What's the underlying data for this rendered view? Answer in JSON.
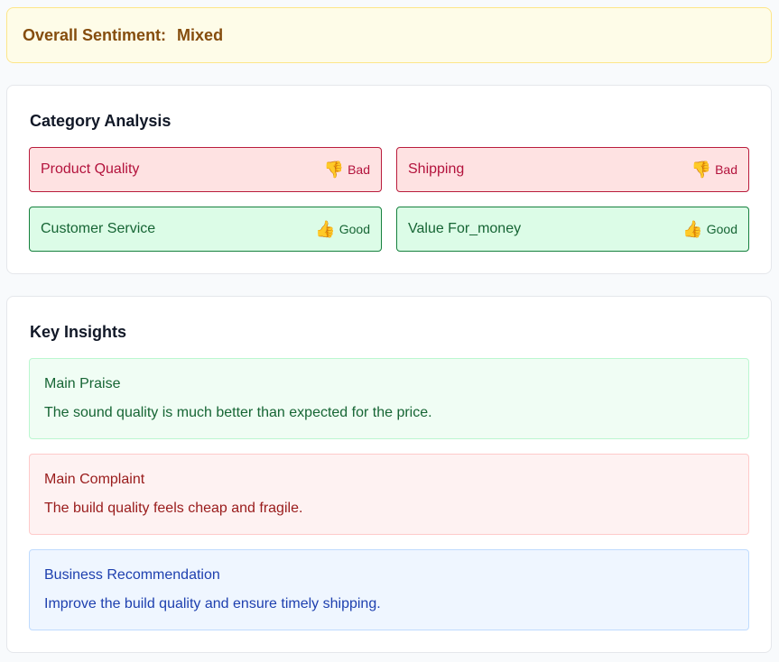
{
  "sentiment": {
    "label": "Overall Sentiment:",
    "value": "Mixed"
  },
  "categories": {
    "title": "Category Analysis",
    "items": [
      {
        "name": "Product Quality",
        "rating": "Bad",
        "icon": "thumbs-down-icon"
      },
      {
        "name": "Shipping",
        "rating": "Bad",
        "icon": "thumbs-down-icon"
      },
      {
        "name": "Customer Service",
        "rating": "Good",
        "icon": "thumbs-up-icon"
      },
      {
        "name": "Value For_money",
        "rating": "Good",
        "icon": "thumbs-up-icon"
      }
    ]
  },
  "insights": {
    "title": "Key Insights",
    "praise": {
      "title": "Main Praise",
      "text": "The sound quality is much better than expected for the price."
    },
    "complaint": {
      "title": "Main Complaint",
      "text": "The build quality feels cheap and fragile."
    },
    "recommendation": {
      "title": "Business Recommendation",
      "text": "Improve the build quality and ensure timely shipping."
    }
  },
  "colors": {
    "bad": "#b3123c",
    "good": "#166534",
    "sentiment": "#854d0e",
    "recommendation": "#1e40af"
  }
}
